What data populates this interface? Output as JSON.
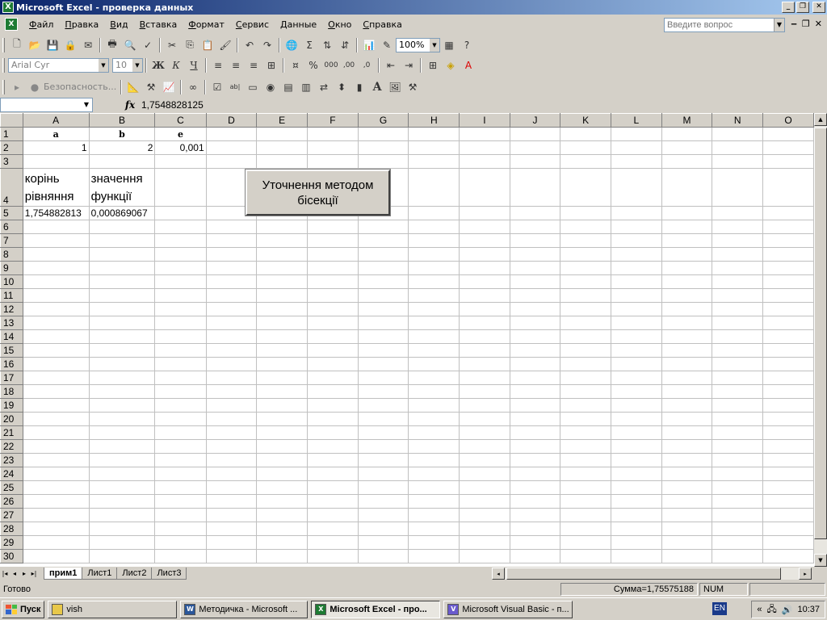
{
  "window": {
    "title": "Microsoft Excel - проверка данных"
  },
  "menu": {
    "items": [
      "Файл",
      "Правка",
      "Вид",
      "Вставка",
      "Формат",
      "Сервис",
      "Данные",
      "Окно",
      "Справка"
    ],
    "ask_placeholder": "Введите вопрос"
  },
  "toolbar": {
    "zoom": "100%",
    "font_name": "Arial Cyr",
    "font_size": "10",
    "security_label": "Безопасность..."
  },
  "formula_bar": {
    "name_box": "",
    "fx": "fx",
    "value": "1,7548828125"
  },
  "sheet": {
    "columns": [
      "A",
      "B",
      "C",
      "D",
      "E",
      "F",
      "G",
      "H",
      "I",
      "J",
      "K",
      "L",
      "M",
      "N",
      "O"
    ],
    "rows": [
      "1",
      "2",
      "3",
      "4",
      "5",
      "6",
      "7",
      "8",
      "9",
      "10",
      "11",
      "12",
      "13",
      "14",
      "15",
      "16",
      "17",
      "18",
      "19",
      "20",
      "21",
      "22",
      "23",
      "24",
      "25",
      "26",
      "27",
      "28",
      "29",
      "30"
    ],
    "cells": {
      "A1": "a",
      "B1": "b",
      "C1": "e",
      "A2": "1",
      "B2": "2",
      "C2": "0,001",
      "A4_line1": "корінь",
      "A4_line2": "рівняння",
      "B4_line1": "значення",
      "B4_line2": "функції",
      "A5": "1,754882813",
      "B5": "0,000869067"
    },
    "button": {
      "line1": "Уточнення методом",
      "line2": "бісекції"
    },
    "tabs": [
      "прим1",
      "Лист1",
      "Лист2",
      "Лист3"
    ],
    "active_tab": "прим1"
  },
  "status": {
    "ready": "Готово",
    "sum": "Сумма=1,75575188",
    "num": "NUM"
  },
  "taskbar": {
    "start": "Пуск",
    "tasks": [
      "vish",
      "Методичка - Microsoft ...",
      "Microsoft Excel - про...",
      "Microsoft Visual Basic - п..."
    ],
    "lang": "EN",
    "tray_arrows": "«",
    "clock": "10:37"
  }
}
